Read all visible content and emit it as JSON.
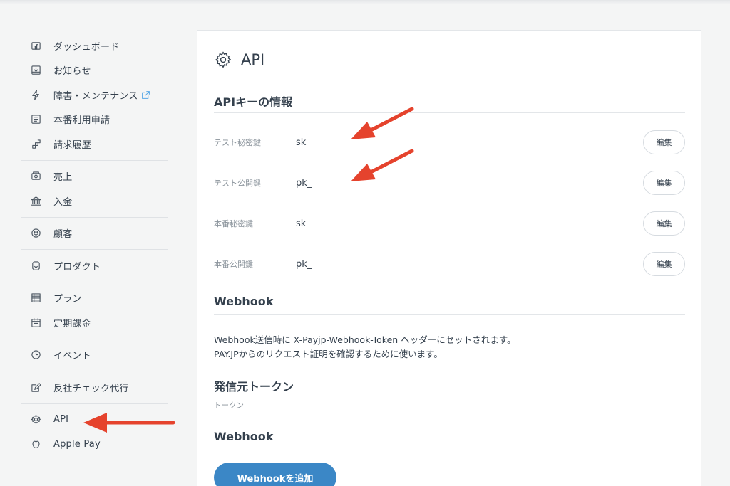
{
  "sidebar": {
    "groups": [
      [
        {
          "label": "ダッシュボード",
          "icon": "dashboard-icon"
        },
        {
          "label": "お知らせ",
          "icon": "inbox-icon"
        },
        {
          "label": "障害・メンテナンス",
          "icon": "lightning-icon",
          "external": true
        },
        {
          "label": "本番利用申請",
          "icon": "form-icon"
        },
        {
          "label": "請求履歴",
          "icon": "history-icon"
        }
      ],
      [
        {
          "label": "売上",
          "icon": "sales-icon"
        },
        {
          "label": "入金",
          "icon": "bank-icon"
        }
      ],
      [
        {
          "label": "顧客",
          "icon": "smiley-icon"
        }
      ],
      [
        {
          "label": "プロダクト",
          "icon": "product-icon"
        }
      ],
      [
        {
          "label": "プラン",
          "icon": "list-icon"
        },
        {
          "label": "定期課金",
          "icon": "calendar-icon"
        }
      ],
      [
        {
          "label": "イベント",
          "icon": "clock-icon"
        }
      ],
      [
        {
          "label": "反社チェック代行",
          "icon": "check-edit-icon"
        }
      ],
      [
        {
          "label": "API",
          "icon": "gear-icon"
        },
        {
          "label": "Apple Pay",
          "icon": "apple-icon"
        }
      ]
    ]
  },
  "main": {
    "title": "API",
    "api_keys_heading": "APIキーの情報",
    "keys": [
      {
        "label": "テスト秘密鍵",
        "value": "sk_",
        "button": "編集"
      },
      {
        "label": "テスト公開鍵",
        "value": "pk_",
        "button": "編集"
      },
      {
        "label": "本番秘密鍵",
        "value": "sk_",
        "button": "編集"
      },
      {
        "label": "本番公開鍵",
        "value": "pk_",
        "button": "編集"
      }
    ],
    "webhook_heading": "Webhook",
    "webhook_desc_line1": "Webhook送信時に X-Payjp-Webhook-Token ヘッダーにセットされます。",
    "webhook_desc_line2": "PAY.JPからのリクエスト証明を確認するために使います。",
    "token_heading": "発信元トークン",
    "token_label": "トークン",
    "webhook_heading2": "Webhook",
    "add_webhook_button": "Webhookを追加"
  },
  "colors": {
    "accent": "#3b87c6",
    "annotation_arrow": "#e5432d",
    "external_link": "#5aa9e6"
  }
}
